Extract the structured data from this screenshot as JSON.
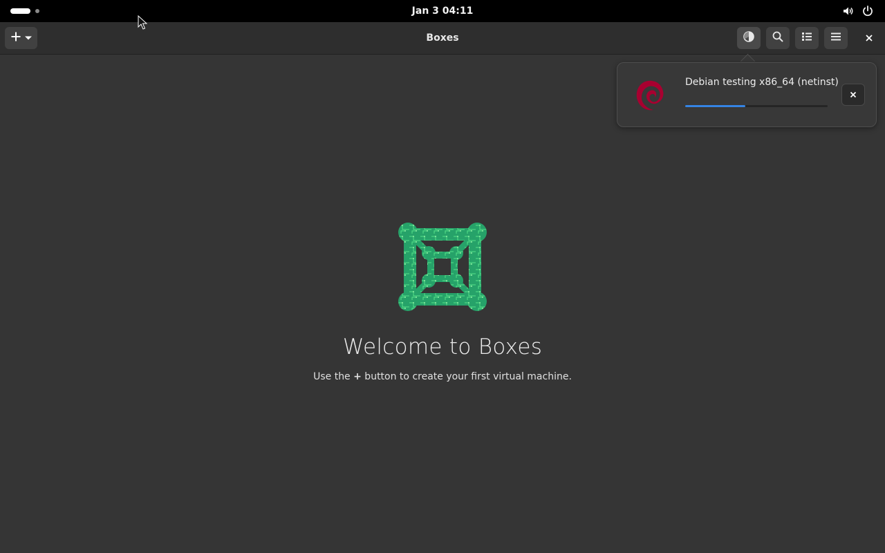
{
  "system_bar": {
    "clock": "Jan 3  04:11",
    "icons": [
      "volume-icon",
      "power-icon"
    ]
  },
  "header": {
    "title": "Boxes",
    "add_icon": "plus-icon",
    "buttons": [
      "downloads-icon",
      "search-icon",
      "list-view-icon",
      "menu-icon",
      "close-icon"
    ]
  },
  "downloads_popover": {
    "name": "Debian testing x86_64 (netinst)",
    "progress": 0.42,
    "icon": "debian-logo",
    "cancel_icon": "close-icon"
  },
  "empty_state": {
    "title": "Welcome to Boxes",
    "hint_prefix": "Use the ",
    "hint_plus": "+",
    "hint_suffix": " button to create your first virtual machine.",
    "logo": "boxes-logo"
  },
  "colors": {
    "accent": "#3584e4",
    "logo_green": "#2ec27e",
    "debian_red": "#a80030"
  }
}
